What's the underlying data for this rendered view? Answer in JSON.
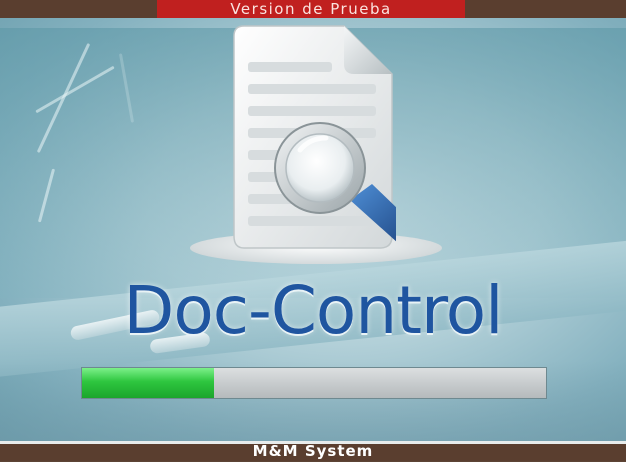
{
  "banner": {
    "trial_label": "Version de Prueba"
  },
  "app": {
    "title": "Doc-Control",
    "icon": "document-search-icon"
  },
  "loading": {
    "progress_fraction": 0.285
  },
  "footer": {
    "company": "M&M System"
  },
  "colors": {
    "banner_bg": "#c0201f",
    "bars_bg": "#5a3e2f",
    "title_text": "#1f55a0",
    "progress_fill": "#2ec63f",
    "progress_track": "#c6cacc"
  }
}
